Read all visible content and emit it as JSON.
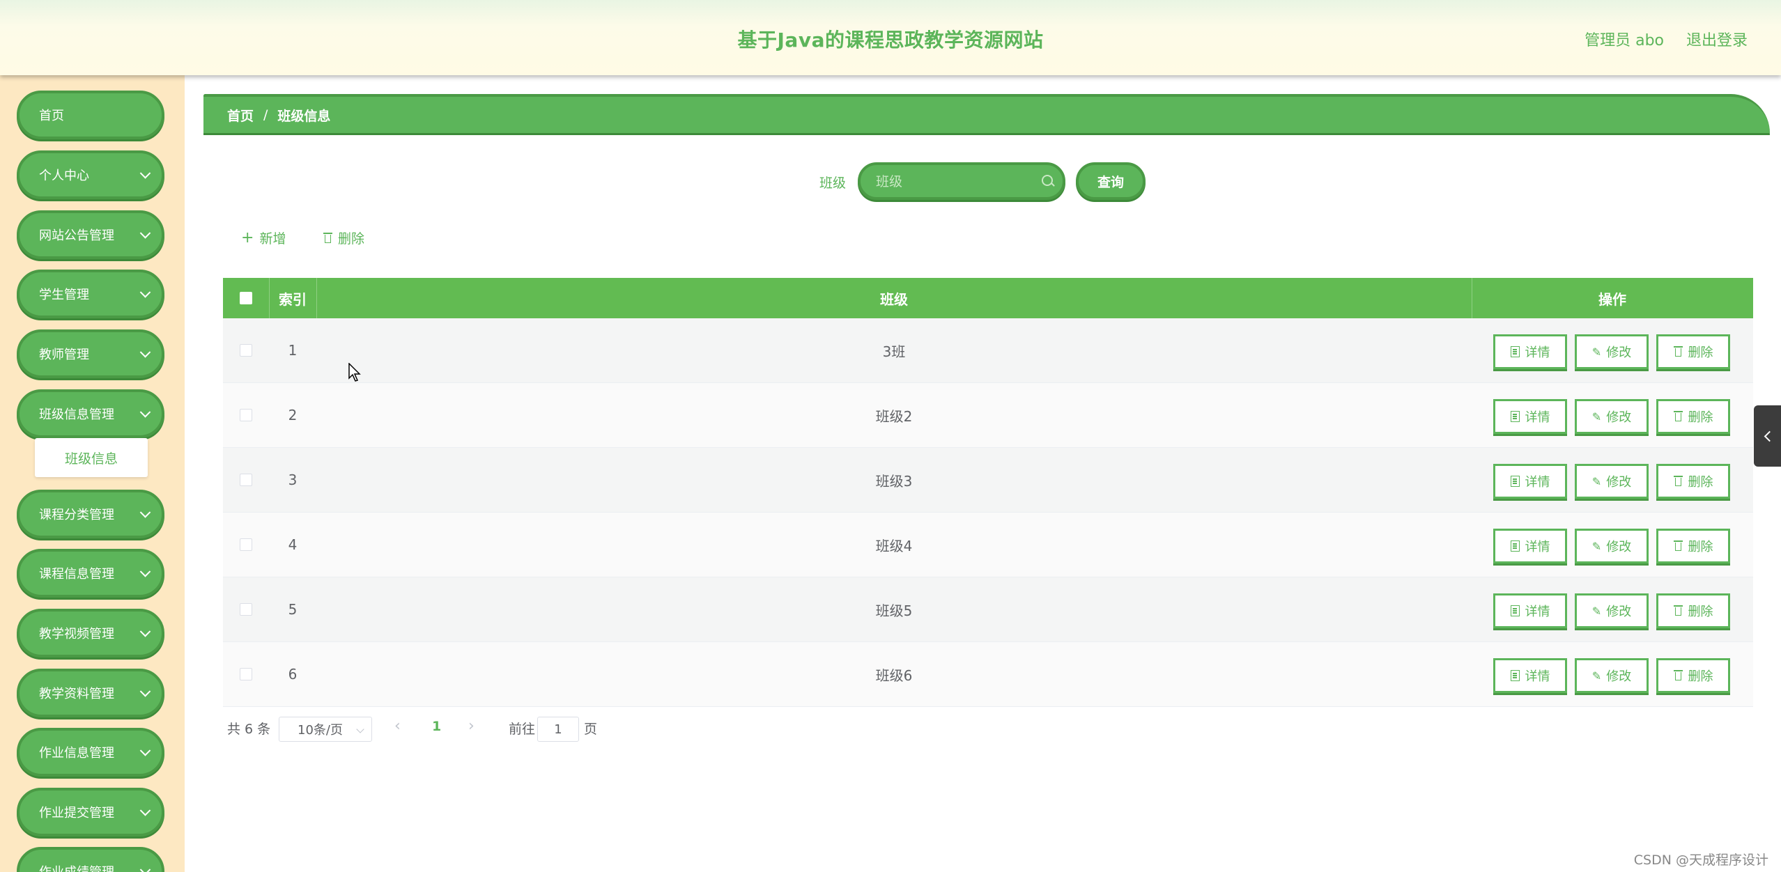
{
  "header": {
    "title": "基于Java的课程思政教学资源网站",
    "user": "管理员 abo",
    "logout": "退出登录"
  },
  "sidebar": {
    "items": [
      {
        "label": "首页",
        "expandable": false
      },
      {
        "label": "个人中心",
        "expandable": true
      },
      {
        "label": "网站公告管理",
        "expandable": true
      },
      {
        "label": "学生管理",
        "expandable": true
      },
      {
        "label": "教师管理",
        "expandable": true
      },
      {
        "label": "班级信息管理",
        "expandable": true
      },
      {
        "label": "课程分类管理",
        "expandable": true
      },
      {
        "label": "课程信息管理",
        "expandable": true
      },
      {
        "label": "教学视频管理",
        "expandable": true
      },
      {
        "label": "教学资料管理",
        "expandable": true
      },
      {
        "label": "作业信息管理",
        "expandable": true
      },
      {
        "label": "作业提交管理",
        "expandable": true
      },
      {
        "label": "作业成绩管理",
        "expandable": true
      }
    ],
    "submenu": {
      "label": "班级信息"
    }
  },
  "breadcrumb": {
    "home": "首页",
    "separator": "/",
    "current": "班级信息"
  },
  "search": {
    "label": "班级",
    "placeholder": "班级",
    "value": "",
    "button": "查询"
  },
  "toolbar": {
    "add": "新增",
    "delete": "删除"
  },
  "table": {
    "columns": {
      "index": "索引",
      "class": "班级",
      "actions": "操作"
    },
    "rows": [
      {
        "index": "1",
        "class": "3班"
      },
      {
        "index": "2",
        "class": "班级2"
      },
      {
        "index": "3",
        "class": "班级3"
      },
      {
        "index": "4",
        "class": "班级4"
      },
      {
        "index": "5",
        "class": "班级5"
      },
      {
        "index": "6",
        "class": "班级6"
      }
    ],
    "actions": {
      "detail": "详情",
      "edit": "修改",
      "delete": "删除"
    }
  },
  "pagination": {
    "total": "共 6 条",
    "page_size": "10条/页",
    "current_page": "1",
    "goto_prefix": "前往",
    "goto_value": "1",
    "goto_suffix": "页"
  },
  "watermark": "CSDN @天成程序设计",
  "colors": {
    "accent": "#5cb55a",
    "sidebar_bg": "#fde8c2",
    "header_bg": "#fffbe5"
  }
}
